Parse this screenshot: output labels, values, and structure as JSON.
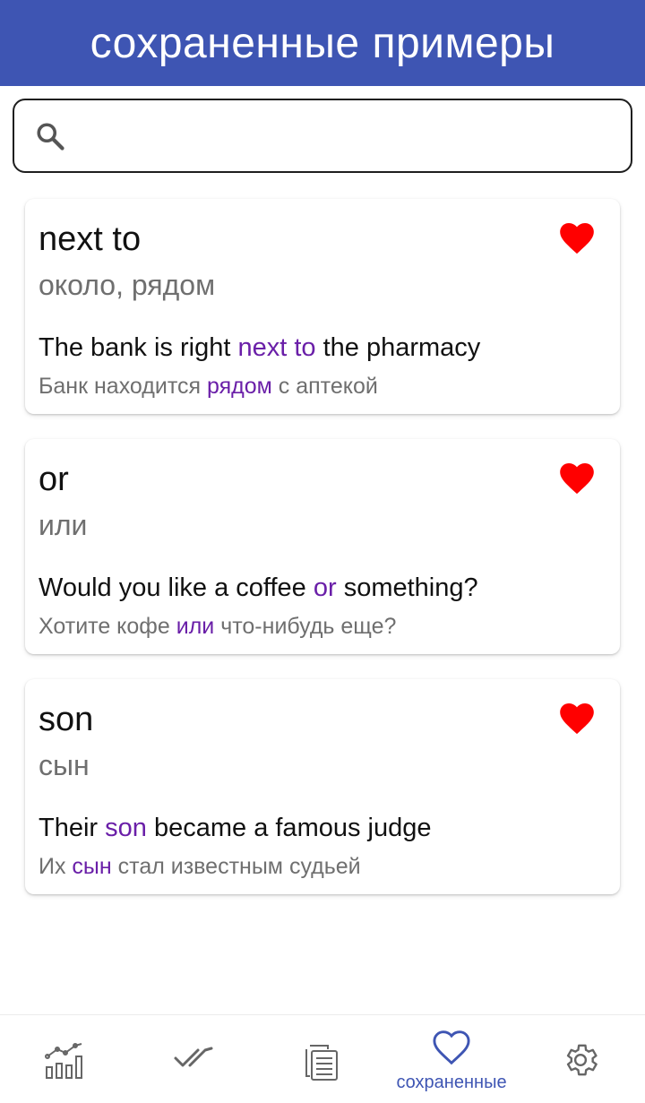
{
  "header": {
    "title": "сохраненные примеры"
  },
  "search": {
    "placeholder": "",
    "value": "",
    "icon": "search-icon"
  },
  "colors": {
    "header_bg": "#3e55b3",
    "highlight": "#6a1fa8",
    "heart": "#ff0000",
    "nav_active": "#3e55b3"
  },
  "cards": [
    {
      "word": "next to",
      "translation": "около, рядом",
      "example_before": "The bank is right ",
      "example_highlight": "next to",
      "example_after": " the pharmacy",
      "example_tr_before": "Банк находится ",
      "example_tr_highlight": "рядом",
      "example_tr_after": " с аптекой",
      "favorite": true
    },
    {
      "word": "or",
      "translation": "или",
      "example_before": "Would you like a coffee ",
      "example_highlight": "or",
      "example_after": " something?",
      "example_tr_before": "Хотите кофе ",
      "example_tr_highlight": "или",
      "example_tr_after": " что-нибудь еще?",
      "favorite": true
    },
    {
      "word": "son",
      "translation": "сын",
      "example_before": "Their ",
      "example_highlight": "son",
      "example_after": " became a famous judge",
      "example_tr_before": "Их ",
      "example_tr_highlight": "сын",
      "example_tr_after": " стал известным судьей",
      "favorite": true
    }
  ],
  "bottom_nav": [
    {
      "icon": "statistics-chart-icon",
      "label": "",
      "active": false
    },
    {
      "icon": "double-check-icon",
      "label": "",
      "active": false
    },
    {
      "icon": "documents-icon",
      "label": "",
      "active": false
    },
    {
      "icon": "heart-outline-icon",
      "label": "сохраненные",
      "active": true
    },
    {
      "icon": "gear-icon",
      "label": "",
      "active": false
    }
  ]
}
